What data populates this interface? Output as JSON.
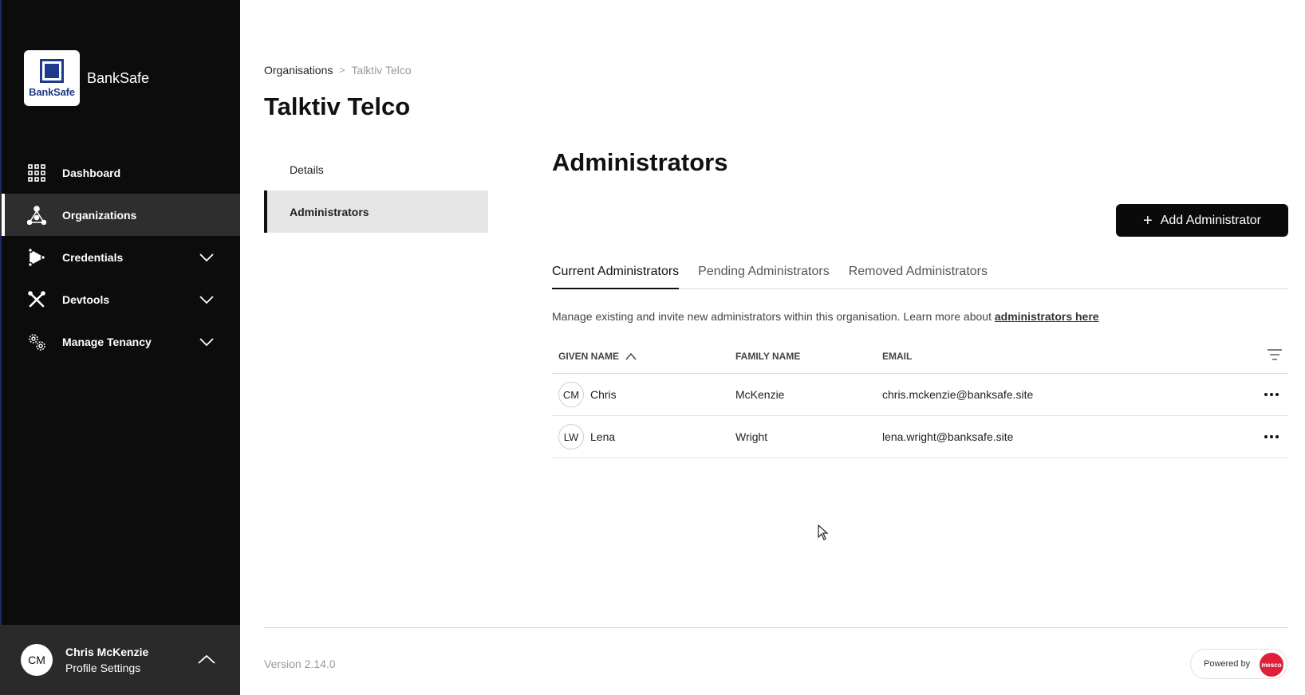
{
  "brand": {
    "logo_text": "BankSafe",
    "name": "BankSafe"
  },
  "sidebar": {
    "items": [
      {
        "label": "Dashboard",
        "icon": "grid-icon",
        "active": false,
        "expandable": false
      },
      {
        "label": "Organizations",
        "icon": "network-icon",
        "active": true,
        "expandable": false
      },
      {
        "label": "Credentials",
        "icon": "credential-icon",
        "active": false,
        "expandable": true
      },
      {
        "label": "Devtools",
        "icon": "tools-icon",
        "active": false,
        "expandable": true
      },
      {
        "label": "Manage Tenancy",
        "icon": "gears-icon",
        "active": false,
        "expandable": true
      }
    ]
  },
  "profile": {
    "initials": "CM",
    "name": "Chris McKenzie",
    "link": "Profile Settings"
  },
  "breadcrumb": {
    "parent": "Organisations",
    "separator": ">",
    "current": "Talktiv Telco"
  },
  "page": {
    "title": "Talktiv Telco"
  },
  "subnav": {
    "items": [
      {
        "label": "Details"
      },
      {
        "label": "Administrators"
      }
    ]
  },
  "section": {
    "title": "Administrators",
    "add_button": "Add Administrator",
    "tabs": [
      "Current Administrators",
      "Pending Administrators",
      "Removed Administrators"
    ],
    "description": "Manage existing and invite new administrators within this organisation. Learn more about ",
    "description_link": "administrators here"
  },
  "table": {
    "columns": {
      "given": "GIVEN NAME",
      "family": "FAMILY NAME",
      "email": "EMAIL"
    },
    "rows": [
      {
        "initials": "CM",
        "given": "Chris",
        "family": "McKenzie",
        "email": "chris.mckenzie@banksafe.site"
      },
      {
        "initials": "LW",
        "given": "Lena",
        "family": "Wright",
        "email": "lena.wright@banksafe.site"
      }
    ]
  },
  "footer": {
    "version": "Version 2.14.0",
    "powered_by": "Powered by",
    "powered_logo": "mesco"
  },
  "colors": {
    "sidebar_bg": "#0c0c0c",
    "accent": "#1e3a8a",
    "button_bg": "#0a0a0a",
    "powered_logo": "#e0203a"
  }
}
